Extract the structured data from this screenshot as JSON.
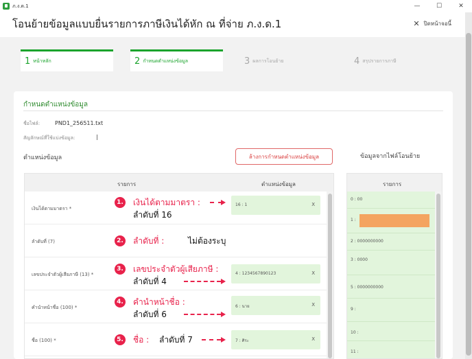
{
  "window": {
    "title": "ภ.ง.ด.1",
    "controls": [
      "—",
      "☐",
      "✕"
    ]
  },
  "header": {
    "title": "โอนย้ายข้อมูลแบบยื่นรายการภาษีเงินได้หัก ณ ที่จ่าย ภ.ง.ด.1",
    "close_label": "ปิดหน้าจอนี้"
  },
  "steps": [
    {
      "num": "1",
      "label": "หน้าหลัก",
      "state": "done"
    },
    {
      "num": "2",
      "label": "กำหนดตำแหน่งข้อมูล",
      "state": "active"
    },
    {
      "num": "3",
      "label": "ผลการโอนย้าย",
      "state": "todo"
    },
    {
      "num": "4",
      "label": "สรุปรายการภาษี",
      "state": "todo"
    }
  ],
  "section": {
    "title": "กำหนดตำแหน่งข้อมูล",
    "file_label": "ชื่อไฟล์:",
    "file_name": "PND1_256511.txt",
    "delimiter_label": "สัญลักษณ์ที่ใช้แบ่งข้อมูล:",
    "delimiter_value": "|",
    "left_title": "ตำแหน่งข้อมูล",
    "clear_button": "ล้างการกำหนดตำแหน่งข้อมูล",
    "right_title": "ข้อมูลจากไฟล์โอนย้าย"
  },
  "left_table": {
    "col_item": "รายการ",
    "col_pos": "ตำแหน่งข้อมูล",
    "rows": [
      {
        "name": "เงินได้ตามมาตรา *",
        "value": "16 : 1",
        "x": "X"
      },
      {
        "name": "ลำดับที่ (7)",
        "value": "",
        "x": ""
      },
      {
        "name": "เลขประจำตัวผู้เสียภาษี (13) *",
        "value": "4 : 1234567890123",
        "x": "X"
      },
      {
        "name": "คำนำหน้าชื่อ (100) *",
        "value": "6 : นาย",
        "x": "X"
      },
      {
        "name": "ชื่อ (100) *",
        "value": "7 : ศิระ",
        "x": "X"
      }
    ]
  },
  "annotations": [
    {
      "num": "1.",
      "red": "เงินได้ตามมาตรา :",
      "black": "ลำดับที่ 16"
    },
    {
      "num": "2.",
      "red": "ลำดับที่ :",
      "black": "ไม่ต้องระบุ"
    },
    {
      "num": "3.",
      "red": "เลขประจำตัวผู้เสียภาษี :",
      "black": "ลำดับที่ 4"
    },
    {
      "num": "4.",
      "red": "คำนำหน้าชื่อ :",
      "black": "ลำดับที่ 6"
    },
    {
      "num": "5.",
      "red": "ชื่อ :",
      "black": "ลำดับที่ 7"
    }
  ],
  "right_table": {
    "col_item": "รายการ",
    "rows": [
      "0 : 00",
      "1 :",
      "2 : 0000000000",
      "3 : 0000",
      "5 : 0000000000",
      "9 :",
      "10 :",
      "11 :"
    ]
  }
}
